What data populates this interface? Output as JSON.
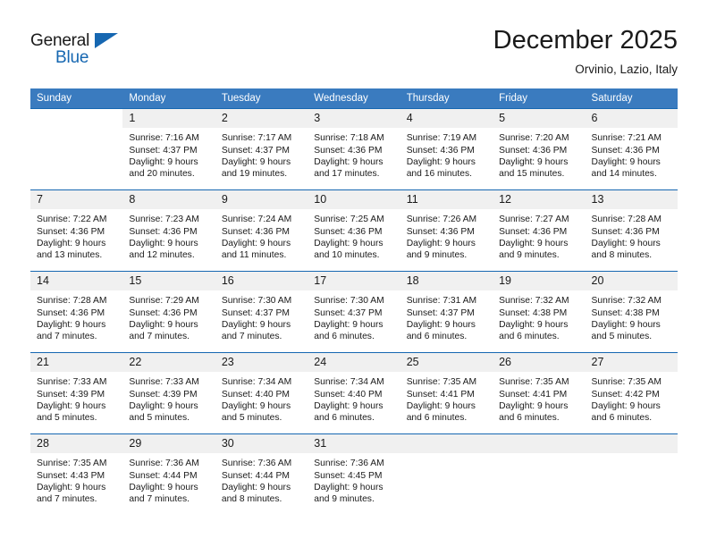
{
  "brand": {
    "word_one": "General",
    "word_two": "Blue",
    "triangle_color": "#1667b1",
    "blue_color": "#1667b1"
  },
  "header": {
    "title": "December 2025",
    "location": "Orvinio, Lazio, Italy"
  },
  "theme": {
    "header_row_bg": "#3a7bbf",
    "week_divider": "#1667b1",
    "daynum_bg": "#f0f0f0"
  },
  "weekdays": [
    "Sunday",
    "Monday",
    "Tuesday",
    "Wednesday",
    "Thursday",
    "Friday",
    "Saturday"
  ],
  "weeks": [
    [
      {
        "day": "",
        "blank": true,
        "lines": []
      },
      {
        "day": "1",
        "lines": [
          "Sunrise: 7:16 AM",
          "Sunset: 4:37 PM",
          "Daylight: 9 hours",
          "and 20 minutes."
        ]
      },
      {
        "day": "2",
        "lines": [
          "Sunrise: 7:17 AM",
          "Sunset: 4:37 PM",
          "Daylight: 9 hours",
          "and 19 minutes."
        ]
      },
      {
        "day": "3",
        "lines": [
          "Sunrise: 7:18 AM",
          "Sunset: 4:36 PM",
          "Daylight: 9 hours",
          "and 17 minutes."
        ]
      },
      {
        "day": "4",
        "lines": [
          "Sunrise: 7:19 AM",
          "Sunset: 4:36 PM",
          "Daylight: 9 hours",
          "and 16 minutes."
        ]
      },
      {
        "day": "5",
        "lines": [
          "Sunrise: 7:20 AM",
          "Sunset: 4:36 PM",
          "Daylight: 9 hours",
          "and 15 minutes."
        ]
      },
      {
        "day": "6",
        "lines": [
          "Sunrise: 7:21 AM",
          "Sunset: 4:36 PM",
          "Daylight: 9 hours",
          "and 14 minutes."
        ]
      }
    ],
    [
      {
        "day": "7",
        "lines": [
          "Sunrise: 7:22 AM",
          "Sunset: 4:36 PM",
          "Daylight: 9 hours",
          "and 13 minutes."
        ]
      },
      {
        "day": "8",
        "lines": [
          "Sunrise: 7:23 AM",
          "Sunset: 4:36 PM",
          "Daylight: 9 hours",
          "and 12 minutes."
        ]
      },
      {
        "day": "9",
        "lines": [
          "Sunrise: 7:24 AM",
          "Sunset: 4:36 PM",
          "Daylight: 9 hours",
          "and 11 minutes."
        ]
      },
      {
        "day": "10",
        "lines": [
          "Sunrise: 7:25 AM",
          "Sunset: 4:36 PM",
          "Daylight: 9 hours",
          "and 10 minutes."
        ]
      },
      {
        "day": "11",
        "lines": [
          "Sunrise: 7:26 AM",
          "Sunset: 4:36 PM",
          "Daylight: 9 hours",
          "and 9 minutes."
        ]
      },
      {
        "day": "12",
        "lines": [
          "Sunrise: 7:27 AM",
          "Sunset: 4:36 PM",
          "Daylight: 9 hours",
          "and 9 minutes."
        ]
      },
      {
        "day": "13",
        "lines": [
          "Sunrise: 7:28 AM",
          "Sunset: 4:36 PM",
          "Daylight: 9 hours",
          "and 8 minutes."
        ]
      }
    ],
    [
      {
        "day": "14",
        "lines": [
          "Sunrise: 7:28 AM",
          "Sunset: 4:36 PM",
          "Daylight: 9 hours",
          "and 7 minutes."
        ]
      },
      {
        "day": "15",
        "lines": [
          "Sunrise: 7:29 AM",
          "Sunset: 4:36 PM",
          "Daylight: 9 hours",
          "and 7 minutes."
        ]
      },
      {
        "day": "16",
        "lines": [
          "Sunrise: 7:30 AM",
          "Sunset: 4:37 PM",
          "Daylight: 9 hours",
          "and 7 minutes."
        ]
      },
      {
        "day": "17",
        "lines": [
          "Sunrise: 7:30 AM",
          "Sunset: 4:37 PM",
          "Daylight: 9 hours",
          "and 6 minutes."
        ]
      },
      {
        "day": "18",
        "lines": [
          "Sunrise: 7:31 AM",
          "Sunset: 4:37 PM",
          "Daylight: 9 hours",
          "and 6 minutes."
        ]
      },
      {
        "day": "19",
        "lines": [
          "Sunrise: 7:32 AM",
          "Sunset: 4:38 PM",
          "Daylight: 9 hours",
          "and 6 minutes."
        ]
      },
      {
        "day": "20",
        "lines": [
          "Sunrise: 7:32 AM",
          "Sunset: 4:38 PM",
          "Daylight: 9 hours",
          "and 5 minutes."
        ]
      }
    ],
    [
      {
        "day": "21",
        "lines": [
          "Sunrise: 7:33 AM",
          "Sunset: 4:39 PM",
          "Daylight: 9 hours",
          "and 5 minutes."
        ]
      },
      {
        "day": "22",
        "lines": [
          "Sunrise: 7:33 AM",
          "Sunset: 4:39 PM",
          "Daylight: 9 hours",
          "and 5 minutes."
        ]
      },
      {
        "day": "23",
        "lines": [
          "Sunrise: 7:34 AM",
          "Sunset: 4:40 PM",
          "Daylight: 9 hours",
          "and 5 minutes."
        ]
      },
      {
        "day": "24",
        "lines": [
          "Sunrise: 7:34 AM",
          "Sunset: 4:40 PM",
          "Daylight: 9 hours",
          "and 6 minutes."
        ]
      },
      {
        "day": "25",
        "lines": [
          "Sunrise: 7:35 AM",
          "Sunset: 4:41 PM",
          "Daylight: 9 hours",
          "and 6 minutes."
        ]
      },
      {
        "day": "26",
        "lines": [
          "Sunrise: 7:35 AM",
          "Sunset: 4:41 PM",
          "Daylight: 9 hours",
          "and 6 minutes."
        ]
      },
      {
        "day": "27",
        "lines": [
          "Sunrise: 7:35 AM",
          "Sunset: 4:42 PM",
          "Daylight: 9 hours",
          "and 6 minutes."
        ]
      }
    ],
    [
      {
        "day": "28",
        "lines": [
          "Sunrise: 7:35 AM",
          "Sunset: 4:43 PM",
          "Daylight: 9 hours",
          "and 7 minutes."
        ]
      },
      {
        "day": "29",
        "lines": [
          "Sunrise: 7:36 AM",
          "Sunset: 4:44 PM",
          "Daylight: 9 hours",
          "and 7 minutes."
        ]
      },
      {
        "day": "30",
        "lines": [
          "Sunrise: 7:36 AM",
          "Sunset: 4:44 PM",
          "Daylight: 9 hours",
          "and 8 minutes."
        ]
      },
      {
        "day": "31",
        "lines": [
          "Sunrise: 7:36 AM",
          "Sunset: 4:45 PM",
          "Daylight: 9 hours",
          "and 9 minutes."
        ]
      },
      {
        "day": "",
        "empty": true,
        "lines": []
      },
      {
        "day": "",
        "empty": true,
        "lines": []
      },
      {
        "day": "",
        "empty": true,
        "lines": []
      }
    ]
  ]
}
